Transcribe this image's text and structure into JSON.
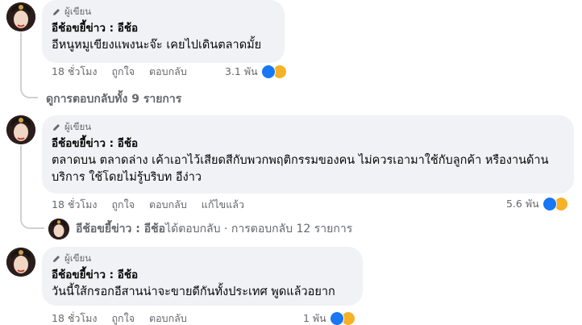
{
  "badge_label": "ผู้เขียน",
  "comments": [
    {
      "author": "อีช้อขยี้ข่าว : อีช้อ",
      "text": "อีหนูหมูเขียงแพงนะจ๊ะ เคยไปเดินตลาดมั้ย",
      "time": "18 ชั่วโมง",
      "like": "ถูกใจ",
      "reply": "ตอบกลับ",
      "edited": "",
      "reaction_count": "3.1 พัน"
    },
    {
      "author": "อีช้อขยี้ข่าว : อีช้อ",
      "text": "ตลาดบน ตลาดล่าง เค้าเอาไว้เสียดสีกับพวกพฤติกรรมของคน ไม่ควรเอามาใช้กับลูกค้า หรืองานด้านบริการ ใช้โดยไม่รู้บริบท อีง่าว",
      "time": "18 ชั่วโมง",
      "like": "ถูกใจ",
      "reply": "ตอบกลับ",
      "edited": "แก้ไขแล้ว",
      "reaction_count": "5.6 พัน"
    },
    {
      "author": "อีช้อขยี้ข่าว : อีช้อ",
      "text": "วันนี้ใส้กรอกอีสานน่าจะขายดีกันทั้งประเทศ พูดแล้วอยาก",
      "time": "18 ชั่วโมง",
      "like": "ถูกใจ",
      "reply": "ตอบกลับ",
      "edited": "",
      "reaction_count": "1 พัน"
    }
  ],
  "view_replies": "ดูการตอบกลับทั้ง 9 รายการ",
  "reply_summary": {
    "name": "อีช้อขยี้ข่าว : อีช้อ",
    "action": " ได้ตอบกลับ · การตอบกลับ 12 รายการ"
  },
  "colors": {
    "bubble": "#f0f2f5",
    "muted_text": "#65676b",
    "like_blue": "#1877f2",
    "haha_yellow": "#f7b125"
  }
}
